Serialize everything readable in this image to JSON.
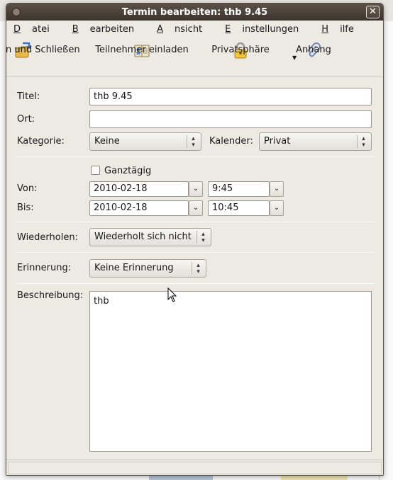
{
  "window": {
    "title": "Termin bearbeiten: thb 9.45",
    "close_glyph": "✕"
  },
  "menu": {
    "items": [
      {
        "label": "Datei",
        "mnemonic": "D",
        "rest": "atei"
      },
      {
        "label": "Bearbeiten",
        "mnemonic": "B",
        "rest": "earbeiten"
      },
      {
        "label": "Ansicht",
        "mnemonic": "A",
        "rest": "nsicht"
      },
      {
        "label": "Einstellungen",
        "mnemonic": "E",
        "rest": "instellungen"
      },
      {
        "label": "Hilfe",
        "mnemonic": "H",
        "rest": "ilfe"
      }
    ]
  },
  "toolbar": {
    "save_close": "Speichern und Schließen",
    "invite": "Teilnehmer einladen",
    "privacy": "Privatsphäre",
    "attachment": "Anhang",
    "icons": {
      "save_close": "folder-save-icon",
      "invite": "address-book-icon",
      "privacy": "padlock-icon",
      "attachment": "paperclip-icon"
    }
  },
  "form": {
    "title_label": "Titel:",
    "title_value": "thb 9.45",
    "location_label": "Ort:",
    "location_value": "",
    "category_label": "Kategorie:",
    "category_value": "Keine",
    "calendar_label": "Kalender:",
    "calendar_value": "Privat",
    "allday_label": "Ganztägig",
    "allday_checked": false,
    "from_label": "Von:",
    "from_date": "2010-02-18",
    "from_time": "9:45",
    "to_label": "Bis:",
    "to_date": "2010-02-18",
    "to_time": "10:45",
    "repeat_label": "Wiederholen:",
    "repeat_value": "Wiederholt sich nicht",
    "reminder_label": "Erinnerung:",
    "reminder_value": "Keine Erinnerung",
    "description_label": "Beschreibung:",
    "description_value": "thb"
  },
  "colors": {
    "titlebar": "#4a4139",
    "window_bg": "#ede9e3"
  }
}
